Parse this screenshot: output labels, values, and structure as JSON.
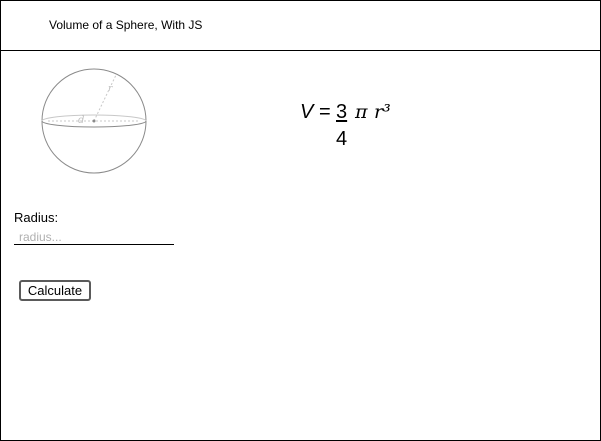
{
  "header": {
    "title": "Volume of a Sphere, With JS"
  },
  "diagram": {
    "radius_label": "r",
    "diameter_label": "d"
  },
  "formula": {
    "lhs": "V",
    "equals": "=",
    "numerator": "3",
    "denominator": "4",
    "pi": "π",
    "r_cubed": "r³"
  },
  "form": {
    "radius_label": "Radius:",
    "radius_placeholder": "radius...",
    "radius_value": "",
    "calculate_label": "Calculate"
  }
}
